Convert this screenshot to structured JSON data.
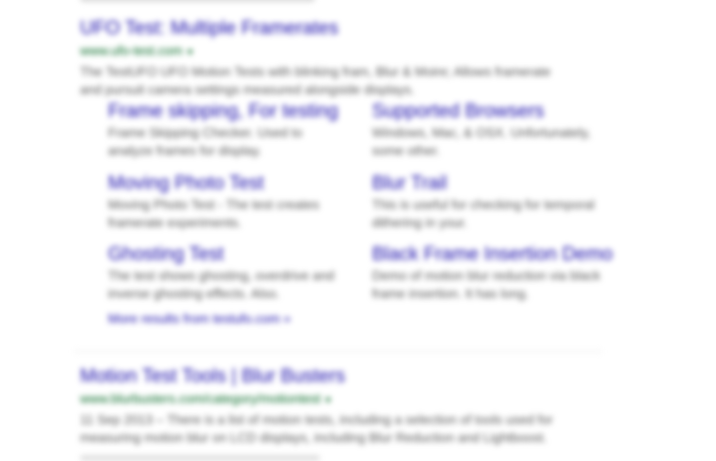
{
  "result1": {
    "title": "UFO Test: Multiple Framerates",
    "url": "www.ufo-test.com",
    "snippet": "The TestUFO UFO Motion Tests with blinking fram, Blur & Moire; Allows framerate and pursuit camera settings measured alongside displays.",
    "sitelinks": [
      {
        "title": "Frame skipping, For testing",
        "desc": "Frame Skipping Checker. Used to analyze frames for display."
      },
      {
        "title": "Supported Browsers",
        "desc": "Windows, Mac, & OSX. Unfortunately, some other."
      },
      {
        "title": "Moving Photo Test",
        "desc": "Moving Photo Test - The test creates framerate experiments."
      },
      {
        "title": "Blur Trail",
        "desc": "This is useful for checking for temporal dithering in your."
      },
      {
        "title": "Ghosting Test",
        "desc": "The test shows ghosting, overdrive and inverse ghosting effects. Also."
      },
      {
        "title": "Black Frame Insertion Demo",
        "desc": "Demo of motion blur reduction via black frame insertion. It has long."
      }
    ],
    "more_link": "More results from testufo.com »"
  },
  "result2": {
    "title": "Motion Test Tools | Blur Busters",
    "url": "www.blurbusters.com/category/motiontest",
    "snippet": "11 Sep 2013 – There is a list of motion tests, including a selection of tools used for measuring motion blur on LCD displays, including Blur Reduction and Lightboost."
  }
}
